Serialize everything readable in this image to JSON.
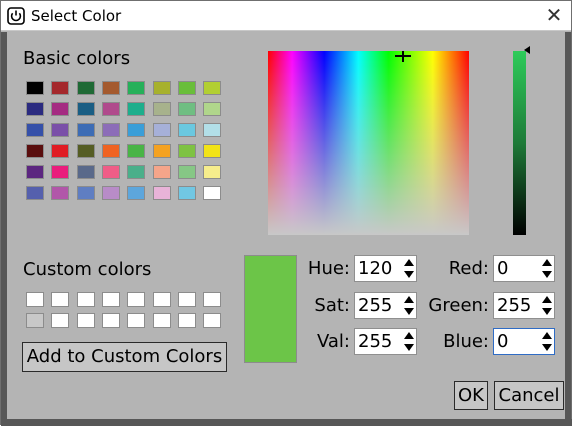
{
  "window": {
    "title": "Select Color",
    "close_glyph": "✕",
    "app_icon": "power-icon"
  },
  "basic_colors": {
    "label": "Basic colors",
    "rows": [
      [
        "#000000",
        "#a4282c",
        "#1f6a35",
        "#a45a2e",
        "#26b05a",
        "#a7b12d",
        "#69be3b",
        "#b2cf32"
      ],
      [
        "#2b2b80",
        "#a52b82",
        "#1a5e84",
        "#b04a8c",
        "#1dae8c",
        "#a7b28c",
        "#6fbe82",
        "#b0d68b"
      ],
      [
        "#3550a9",
        "#7a4fa8",
        "#3d6cb5",
        "#8c6cb8",
        "#3a9ed8",
        "#a6b0d8",
        "#6ac8e0",
        "#b2dfe8"
      ],
      [
        "#5a0e0e",
        "#e01c24",
        "#555d24",
        "#ef6322",
        "#49b446",
        "#f4a221",
        "#7ec242",
        "#f2e317"
      ],
      [
        "#5c2680",
        "#ea1c7c",
        "#59698a",
        "#ef5d87",
        "#4aaf8a",
        "#f5a58a",
        "#86c785",
        "#f6ed8c"
      ],
      [
        "#5560ad",
        "#b156a9",
        "#5f7ec2",
        "#b88cc8",
        "#5da6dc",
        "#e8b3d8",
        "#71c7e3",
        "#ffffff"
      ]
    ]
  },
  "custom_colors": {
    "label": "Custom colors",
    "rows": [
      [
        "#ffffff",
        "#ffffff",
        "#ffffff",
        "#ffffff",
        "#ffffff",
        "#ffffff",
        "#ffffff",
        "#ffffff"
      ],
      [
        "#c8c8c8",
        "#ffffff",
        "#ffffff",
        "#ffffff",
        "#ffffff",
        "#ffffff",
        "#ffffff",
        "#ffffff"
      ]
    ],
    "add_button_label": "Add to Custom Colors"
  },
  "current_color": "#6cc548",
  "fields": {
    "hue": {
      "label": "Hue:",
      "value": "120"
    },
    "sat": {
      "label": "Sat:",
      "value": "255"
    },
    "val": {
      "label": "Val:",
      "value": "255"
    },
    "red": {
      "label": "Red:",
      "value": "0"
    },
    "green": {
      "label": "Green:",
      "value": "255"
    },
    "blue": {
      "label": "Blue:",
      "value": "0"
    }
  },
  "buttons": {
    "ok": "OK",
    "cancel": "Cancel"
  }
}
